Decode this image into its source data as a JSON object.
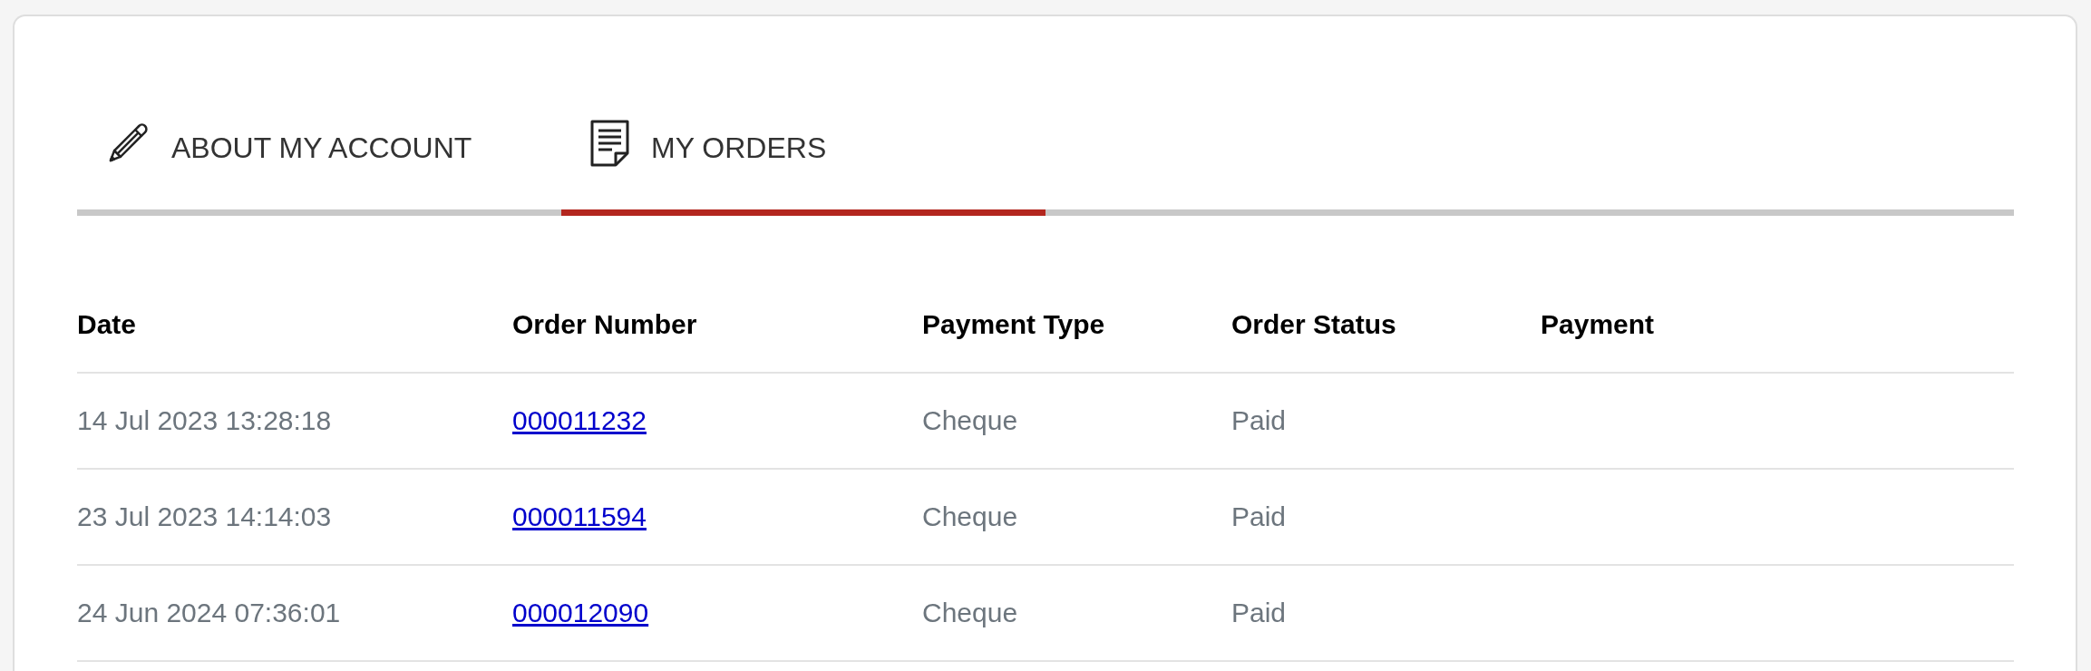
{
  "tabs": [
    {
      "label": "ABOUT MY ACCOUNT",
      "kind": "pencil",
      "selected": false
    },
    {
      "label": "MY ORDERS",
      "kind": "document",
      "selected": true
    }
  ],
  "table": {
    "columns": [
      "Date",
      "Order Number",
      "Payment Type",
      "Order Status",
      "Payment"
    ],
    "rows": [
      {
        "date": "14 Jul 2023 13:28:18",
        "order_number": "000011232",
        "payment_type": "Cheque",
        "order_status": "Paid"
      },
      {
        "date": "23 Jul 2023 14:14:03",
        "order_number": "000011594",
        "payment_type": "Cheque",
        "order_status": "Paid"
      },
      {
        "date": "24 Jun 2024 07:36:01",
        "order_number": "000012090",
        "payment_type": "Cheque",
        "order_status": "Paid"
      }
    ]
  }
}
